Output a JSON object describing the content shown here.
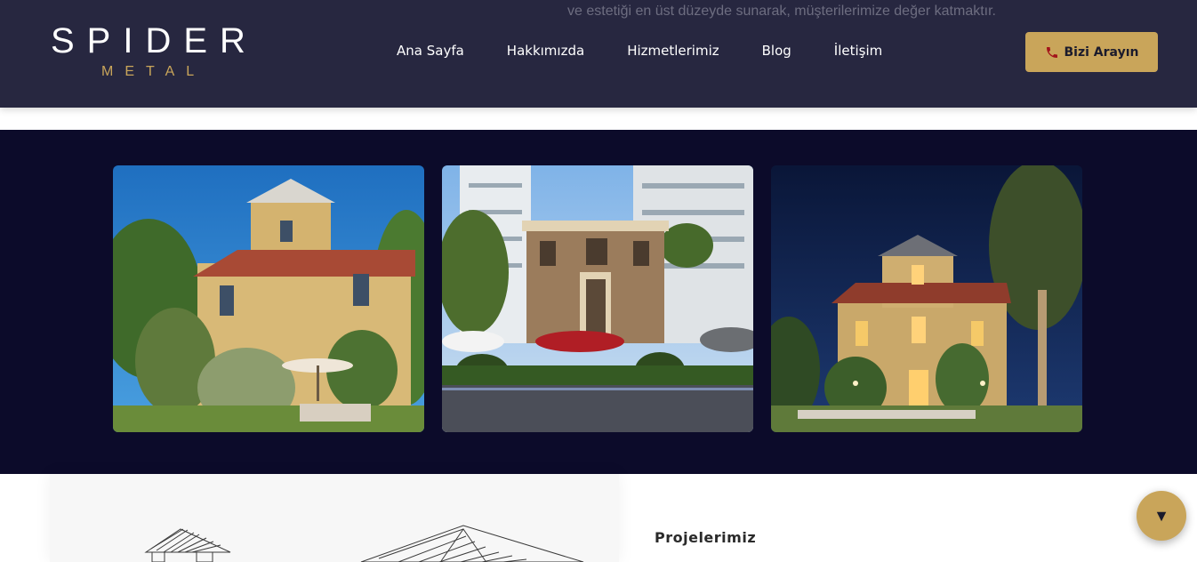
{
  "page": {
    "scrolled_text": "ve estetiği en üst düzeyde sunarak, müşterilerimize değer katmaktır."
  },
  "header": {
    "logo_main": "SPIDER",
    "logo_sub": "METAL",
    "nav": [
      "Ana Sayfa",
      "Hakkımızda",
      "Hizmetlerimiz",
      "Blog",
      "İletişim"
    ],
    "call_button": "Bizi Arayın",
    "call_icon": "phone-icon"
  },
  "gallery": {
    "images": [
      "restored-villa-day",
      "historic-house-with-classic-cars",
      "restored-villa-night"
    ]
  },
  "projects": {
    "title": "Projelerimiz"
  },
  "fab": {
    "icon": "chevron-down-icon",
    "glyph": "▼"
  },
  "colors": {
    "header_bg": "#272740",
    "gallery_bg": "#0c0b2a",
    "accent": "#c9a55a"
  }
}
